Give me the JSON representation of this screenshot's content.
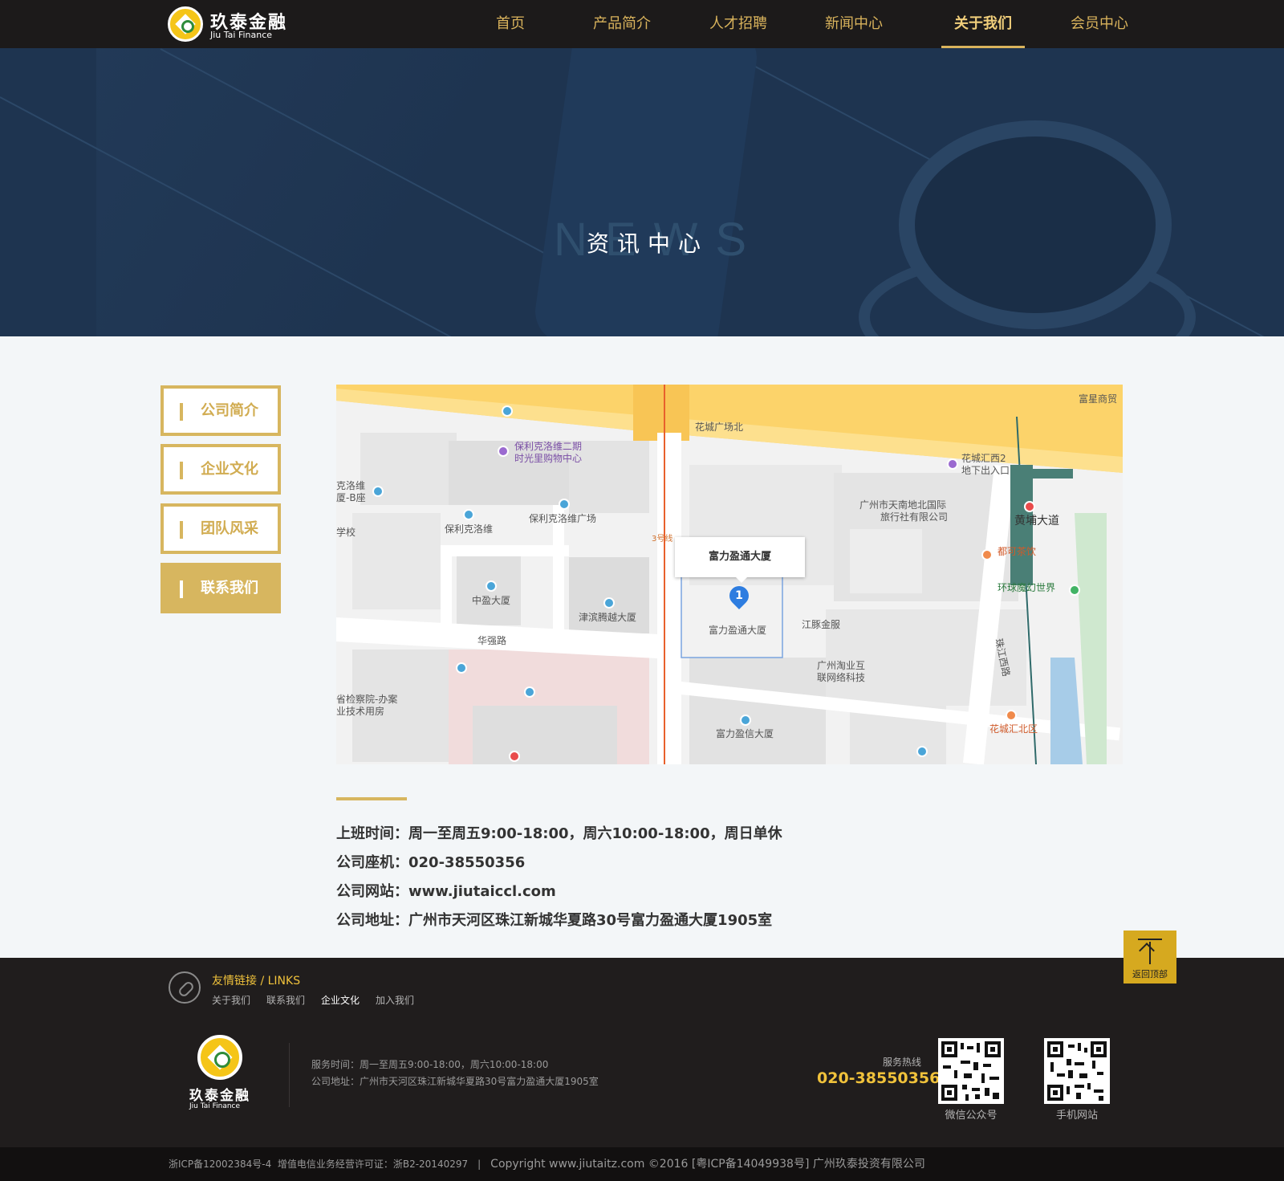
{
  "header": {
    "logo_cn": "玖泰金融",
    "logo_en": "Jiu Tai Finance",
    "nav": [
      {
        "label": "首页",
        "active": false
      },
      {
        "label": "产品简介",
        "active": false
      },
      {
        "label": "人才招聘",
        "active": false
      },
      {
        "label": "新闻中心",
        "active": false
      },
      {
        "label": "关于我们",
        "active": true
      },
      {
        "label": "会员中心",
        "active": false
      }
    ]
  },
  "banner": {
    "bg_word": "NEWS",
    "title": "资讯中心"
  },
  "sidebar": {
    "items": [
      {
        "label": "公司简介",
        "active": false
      },
      {
        "label": "企业文化",
        "active": false
      },
      {
        "label": "团队风采",
        "active": false
      },
      {
        "label": "联系我们",
        "active": true
      }
    ]
  },
  "map": {
    "popup_title": "富力盈通大厦",
    "pin_number": "1",
    "labels": {
      "l1": "花城广场北",
      "l2": "保利克洛维二期",
      "l3": "时光里购物中心",
      "l4": "克洛维",
      "l5": "厦-B座",
      "l6": "保利克洛维",
      "l7": "保利克洛维广场",
      "l8": "学校",
      "l9": "中盈大厦",
      "l10": "津滨腾越大厦",
      "l11": "富力盈通大厦",
      "l12": "华强路",
      "l13": "江豚金服",
      "l14": "广州淘业互",
      "l15": "联网络科技",
      "l16": "省检察院-办案",
      "l17": "业技术用房",
      "l18": "富力盈信大厦",
      "l19": "花城汇西2",
      "l20": "地下出入口",
      "l21": "广州市天南地北国际",
      "l22": "旅行社有限公司",
      "l23": "黄埔大道",
      "l24": "都可茶饮",
      "l25": "环球魔幻世界",
      "l26": "珠江西路",
      "l27": "花城汇北区",
      "l28": "富星商贸",
      "l29": "3号线"
    }
  },
  "contact": {
    "hours_key": "上班时间：",
    "hours_val": "周一至周五9:00-18:00，周六10:00-18:00，周日单休",
    "phone_key": "公司座机：",
    "phone_val": "020-38550356",
    "site_key": "公司网站：",
    "site_val": "www.jiutaiccl.com",
    "addr_key": "公司地址：",
    "addr_val": "广州市天河区珠江新城华夏路30号富力盈通大厦1905室"
  },
  "back_top": {
    "label": "返回顶部"
  },
  "footer": {
    "links_title": "友情链接 / LINKS",
    "links": [
      {
        "label": "关于我们",
        "highlight": false
      },
      {
        "label": "联系我们",
        "highlight": false
      },
      {
        "label": "企业文化",
        "highlight": true
      },
      {
        "label": "加入我们",
        "highlight": false
      }
    ],
    "logo_cn": "玖泰金融",
    "logo_en": "Jiu Tai Finance",
    "service_time": "服务时间：周一至周五9:00-18:00，周六10:00-18:00",
    "address": "公司地址：广州市天河区珠江新城华夏路30号富力盈通大厦1905室",
    "hotline_label": "服务热线",
    "hotline": "020-38550356",
    "qr1_label": "微信公众号",
    "qr2_label": "手机网站"
  },
  "bottom": {
    "icp": "浙ICP备12002384号-4",
    "license": "增值电信业务经营许可证：浙B2-20140297",
    "separator": "|",
    "copyright": "Copyright www.jiutaitz.com ©2016 [粤ICP备14049938号] 广州玖泰投资有限公司"
  },
  "colors": {
    "gold": "#d7b65f",
    "header_bg": "#1c1a1a",
    "banner_bg": "#1e3450",
    "footer_bg": "#201d1d",
    "hotline": "#f0c23b"
  }
}
